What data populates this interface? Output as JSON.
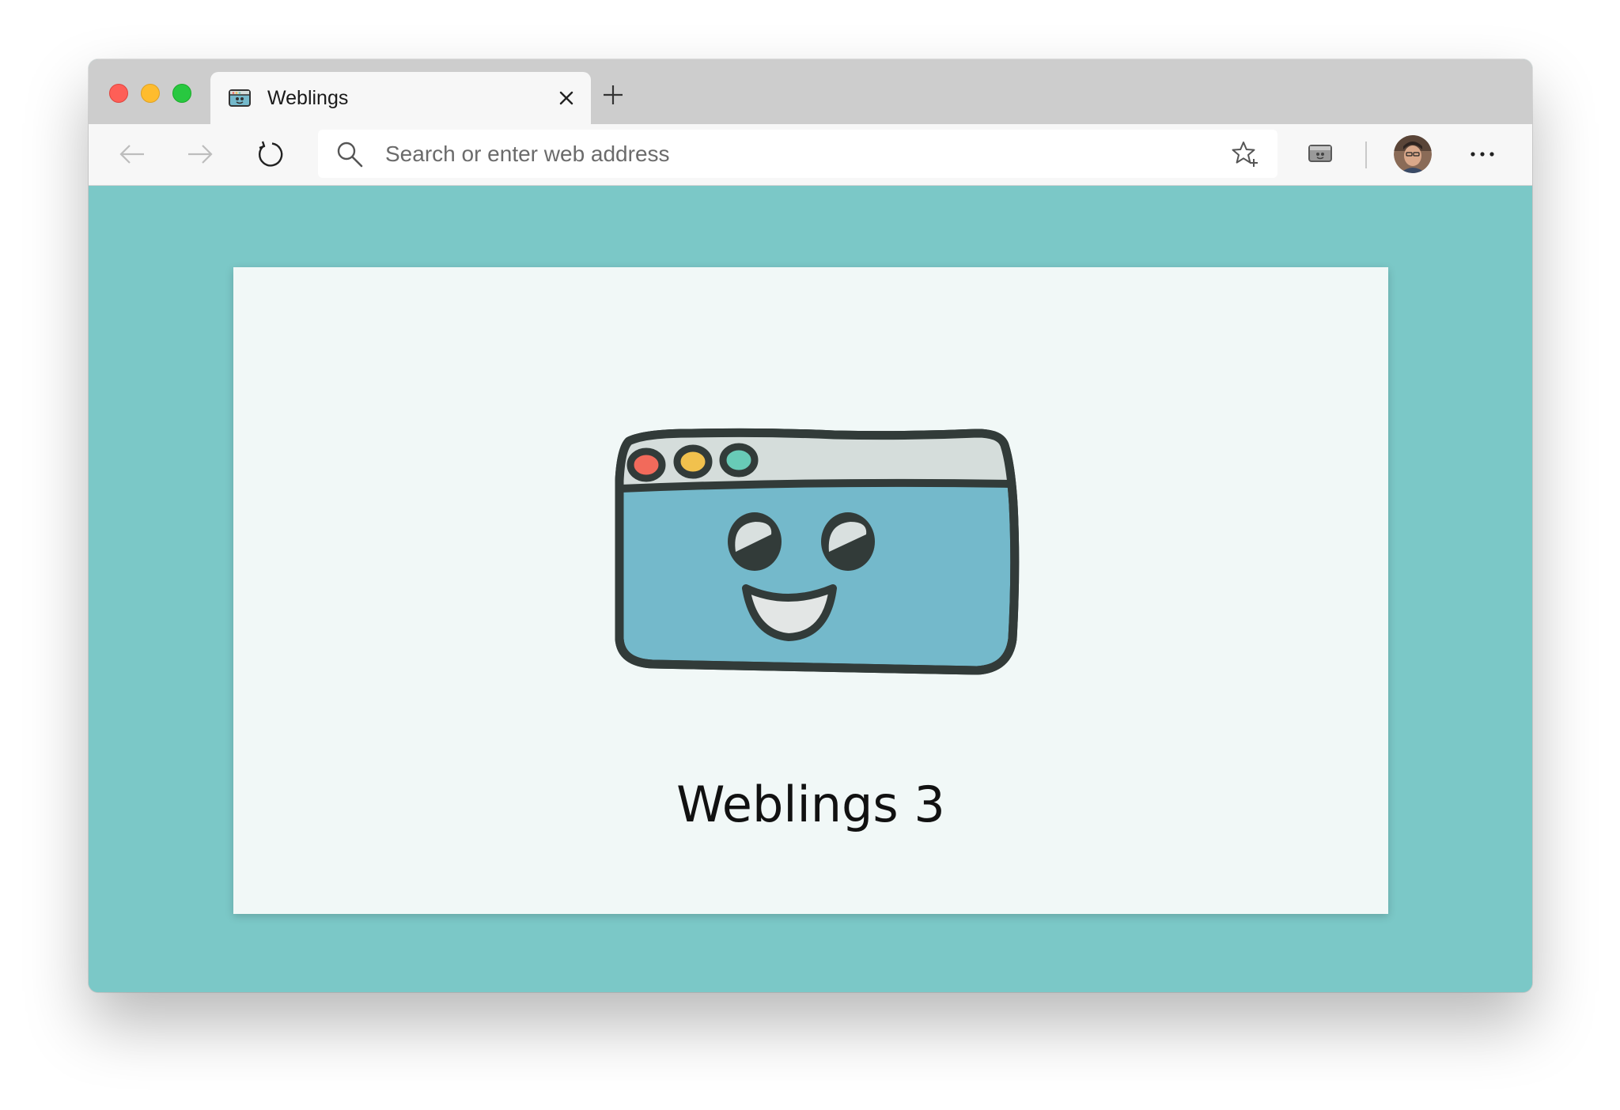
{
  "browser": {
    "tab": {
      "title": "Weblings"
    },
    "address_bar": {
      "placeholder": "Search or enter web address",
      "value": ""
    }
  },
  "page": {
    "heading": "Weblings 3",
    "background_color": "#7bc8c7",
    "card_color": "#f1f8f7",
    "mascot": {
      "icon": "webling-browser-mascot-icon",
      "dot_colors": [
        "#f26a5b",
        "#f1c14d",
        "#68cbb7"
      ],
      "body_color": "#74b9cb",
      "titlebar_color": "#d5dddb"
    }
  }
}
